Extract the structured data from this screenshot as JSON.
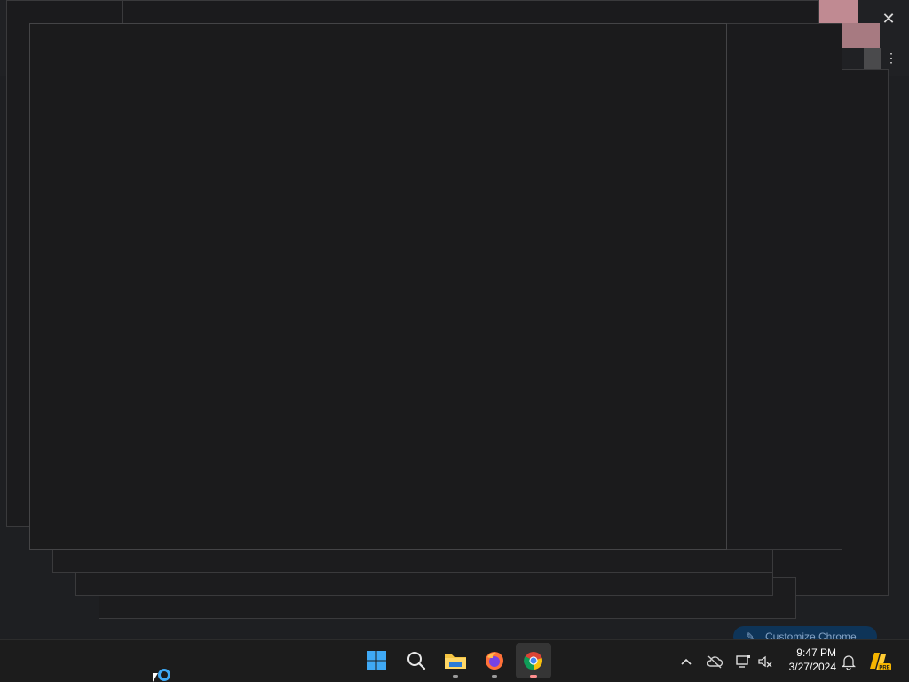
{
  "background": {
    "close_icon": "close-icon",
    "menu_icon": "more-vert-icon",
    "customize_chrome_label": "Customize Chrome",
    "customize_icon": "pencil-icon"
  },
  "taskbar": {
    "apps": [
      {
        "name": "Start",
        "icon": "windows-logo-icon"
      },
      {
        "name": "Search",
        "icon": "search-icon"
      },
      {
        "name": "File Explorer",
        "icon": "folder-icon"
      },
      {
        "name": "Firefox",
        "icon": "firefox-icon"
      },
      {
        "name": "Google Chrome",
        "icon": "chrome-icon"
      }
    ],
    "tray": {
      "overflow_icon": "chevron-up-icon",
      "onedrive_icon": "cloud-off-icon",
      "network_icon": "network-icon",
      "volume_icon": "speaker-muted-icon",
      "notification_icon": "bell-icon",
      "app_badge_icon": "copilot-pre-icon",
      "app_badge_text": "PRE"
    },
    "clock": {
      "time": "9:47 PM",
      "date": "3/27/2024"
    }
  },
  "colors": {
    "accent_blue": "#3fa9f5",
    "chrome_active_dot": "#ff8f8f",
    "taskbar_bg": "#1c1c1c",
    "window_bg": "#1b1b1c"
  }
}
